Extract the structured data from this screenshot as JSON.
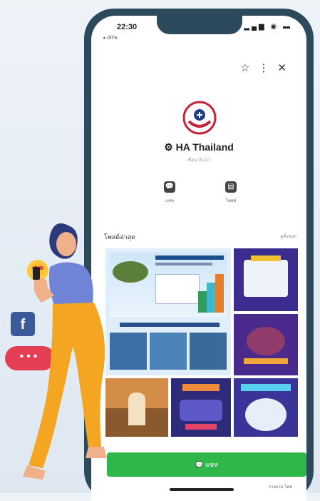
{
  "status": {
    "time": "22:30",
    "back": "◂ เสิร์ช",
    "icons": "▂▄▆ ◉ ▬"
  },
  "topbar": {
    "icons": [
      "star-outline-icon",
      "more-vertical-icon",
      "close-icon"
    ]
  },
  "profile": {
    "name": "⚙ HA Thailand",
    "subtitle": "เพื่อน 15,117"
  },
  "actions": [
    {
      "label": "แชท",
      "icon": "chat-icon"
    },
    {
      "label": "โพสต์",
      "icon": "post-icon"
    }
  ],
  "section": {
    "title": "โพสต์ล่าสุด",
    "more": "ดูทั้งหมด"
  },
  "add_button": {
    "label": "แชท"
  },
  "footer": {
    "text": "รายงาน โพส"
  },
  "colors": {
    "phone_frame": "#2c4a5c",
    "line_green": "#2fb84a",
    "facebook_blue": "#3b5a9a",
    "bubble_red": "#e43e55"
  }
}
